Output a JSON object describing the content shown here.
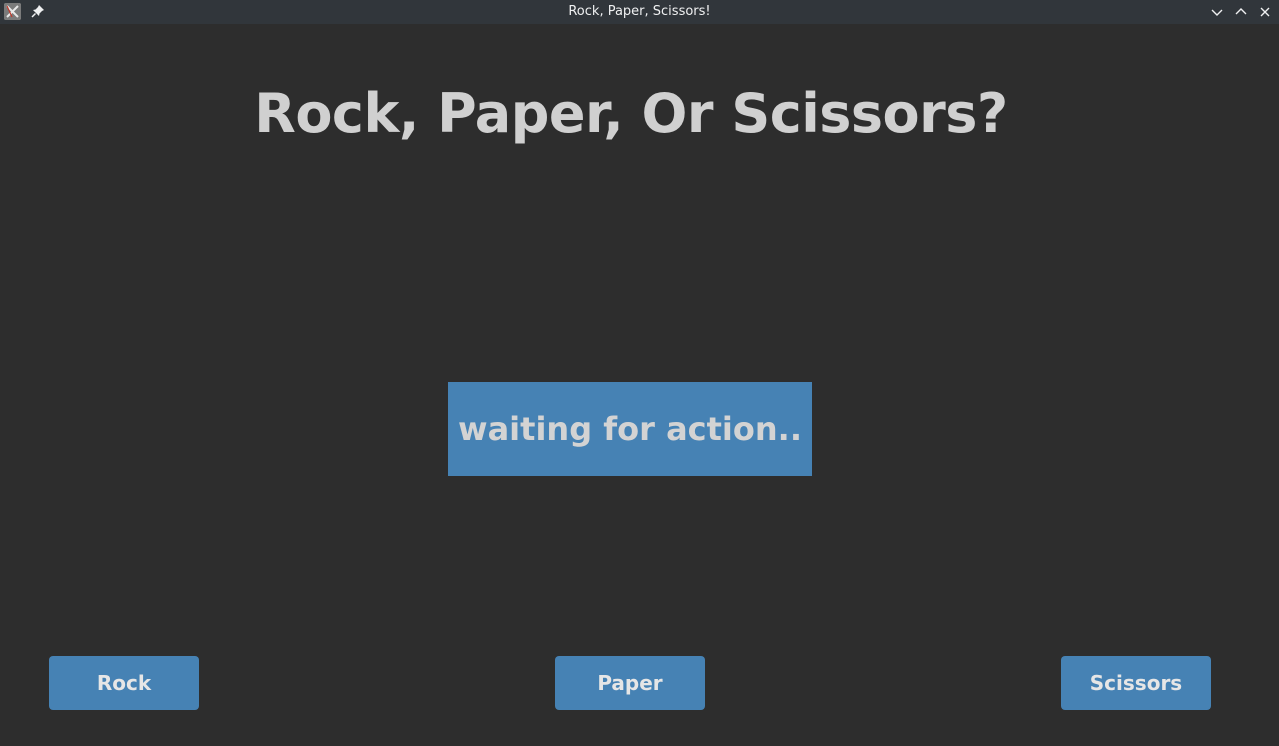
{
  "window": {
    "title": "Rock, Paper, Scissors!",
    "icons": {
      "app": "app-icon",
      "pin": "pin-icon",
      "minimize": "chevron-down-icon",
      "maximize": "chevron-up-icon",
      "close": "close-icon"
    }
  },
  "main": {
    "heading": "Rock, Paper, Or Scissors?",
    "status": "waiting for action.."
  },
  "choices": {
    "rock_label": "Rock",
    "paper_label": "Paper",
    "scissors_label": "Scissors"
  },
  "colors": {
    "background": "#2d2d2d",
    "titlebar": "#31363b",
    "accent": "#4682b4",
    "heading_text": "#d0d0d0"
  }
}
